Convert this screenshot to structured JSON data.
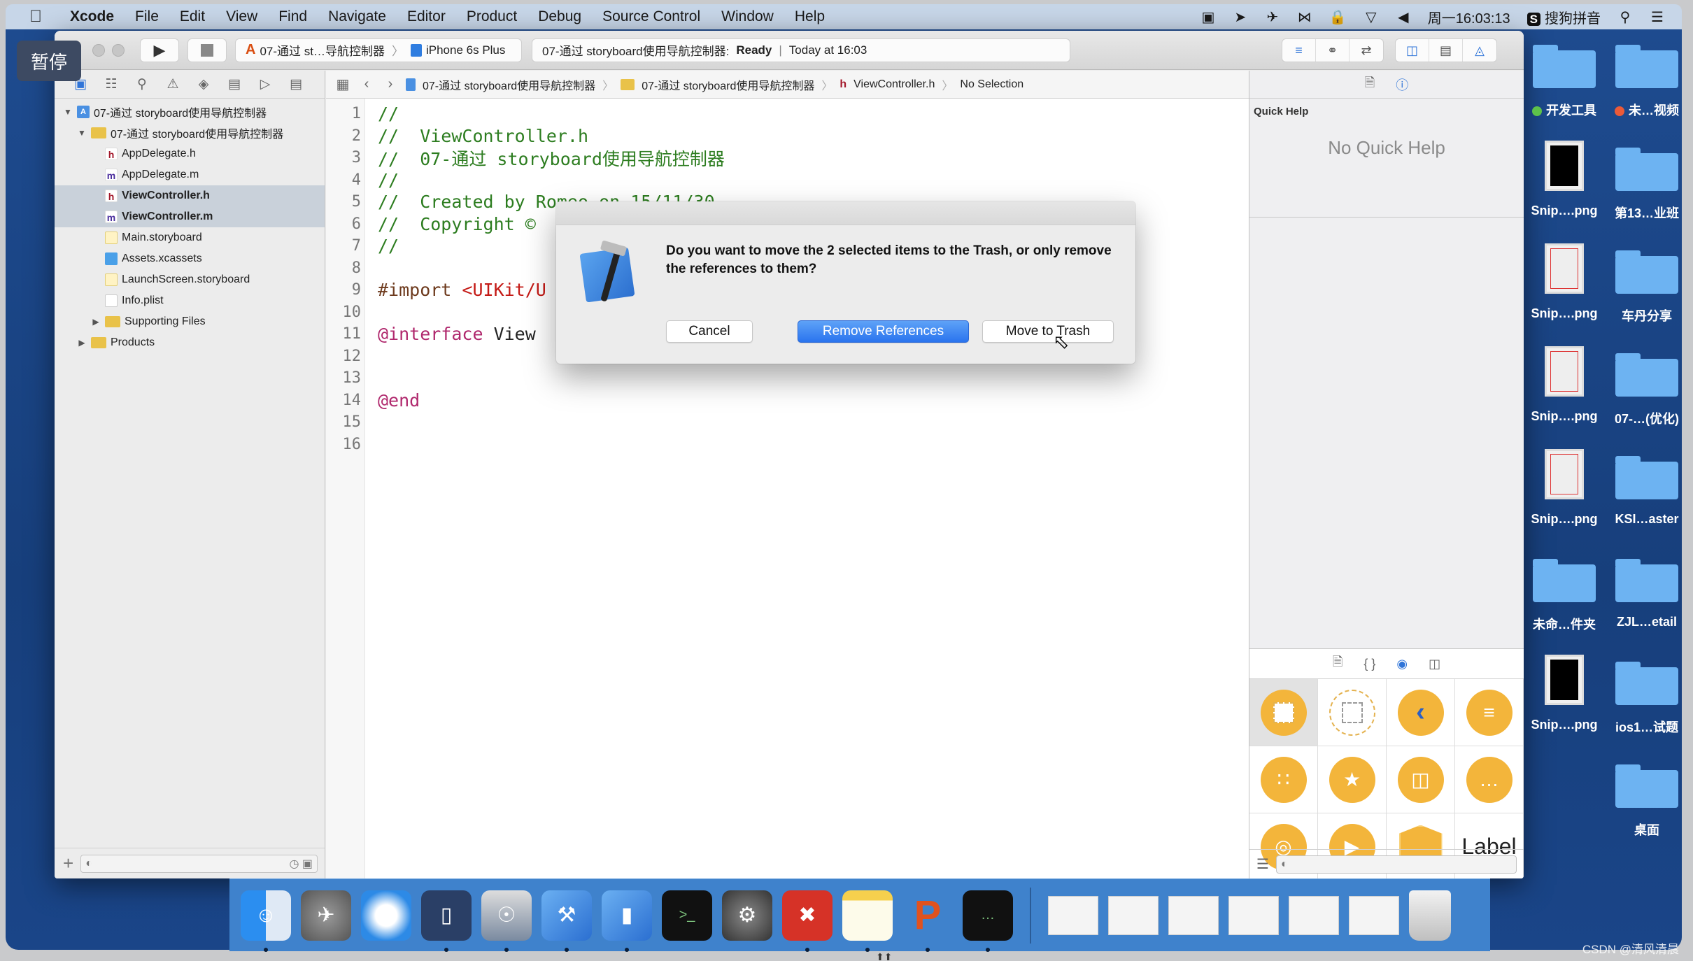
{
  "menubar": {
    "app_name": "Xcode",
    "items": [
      "File",
      "Edit",
      "View",
      "Find",
      "Navigate",
      "Editor",
      "Product",
      "Debug",
      "Source Control",
      "Window",
      "Help"
    ],
    "clock": "周一16:03:13",
    "input_method": "搜狗拼音",
    "status_icons": [
      "screen-record-icon",
      "location-icon",
      "plane-icon",
      "bluetooth-icon",
      "lock-icon",
      "wifi-icon",
      "volume-icon"
    ]
  },
  "overlay": {
    "pause_label": "暂停"
  },
  "toolbar": {
    "scheme_name": "07-通过 st…导航控制器",
    "device_name": "iPhone 6s Plus",
    "activity_project": "07-通过 storyboard使用导航控制器:",
    "activity_status": "Ready",
    "activity_time": "Today at 16:03"
  },
  "navigator": {
    "tree": [
      {
        "label": "07-通过 storyboard使用导航控制器",
        "type": "project",
        "level": 0,
        "expanded": true,
        "selected": false
      },
      {
        "label": "07-通过 storyboard使用导航控制器",
        "type": "folder",
        "level": 1,
        "expanded": true,
        "selected": false
      },
      {
        "label": "AppDelegate.h",
        "type": "h",
        "level": 2,
        "selected": false
      },
      {
        "label": "AppDelegate.m",
        "type": "m",
        "level": 2,
        "selected": false
      },
      {
        "label": "ViewController.h",
        "type": "h",
        "level": 2,
        "selected": true
      },
      {
        "label": "ViewController.m",
        "type": "m",
        "level": 2,
        "selected": true
      },
      {
        "label": "Main.storyboard",
        "type": "storyboard",
        "level": 2,
        "selected": false
      },
      {
        "label": "Assets.xcassets",
        "type": "assets",
        "level": 2,
        "selected": false
      },
      {
        "label": "LaunchScreen.storyboard",
        "type": "storyboard",
        "level": 2,
        "selected": false
      },
      {
        "label": "Info.plist",
        "type": "plist",
        "level": 2,
        "selected": false
      },
      {
        "label": "Supporting Files",
        "type": "folder",
        "level": 2,
        "expanded": false,
        "selected": false
      },
      {
        "label": "Products",
        "type": "folder",
        "level": 1,
        "expanded": false,
        "selected": false
      }
    ]
  },
  "jumpbar": {
    "crumbs": [
      "07-通过 storyboard使用导航控制器",
      "07-通过 storyboard使用导航控制器",
      "ViewController.h",
      "No Selection"
    ]
  },
  "editor": {
    "lines": [
      {
        "n": "1",
        "segments": [
          {
            "t": "//",
            "c": "com"
          }
        ]
      },
      {
        "n": "2",
        "segments": [
          {
            "t": "//  ViewController.h",
            "c": "com"
          }
        ]
      },
      {
        "n": "3",
        "segments": [
          {
            "t": "//  07-通过 storyboard使用导航控制器",
            "c": "com"
          }
        ]
      },
      {
        "n": "4",
        "segments": [
          {
            "t": "//",
            "c": "com"
          }
        ]
      },
      {
        "n": "5",
        "segments": [
          {
            "t": "//  Created by Romeo on 15/11/30",
            "c": "com"
          }
        ]
      },
      {
        "n": "6",
        "segments": [
          {
            "t": "//  Copyright ©",
            "c": "com"
          }
        ]
      },
      {
        "n": "7",
        "segments": [
          {
            "t": "//",
            "c": "com"
          }
        ]
      },
      {
        "n": "8",
        "segments": []
      },
      {
        "n": "9",
        "segments": [
          {
            "t": "#import ",
            "c": "pre"
          },
          {
            "t": "<UIKit/U",
            "c": "str"
          }
        ]
      },
      {
        "n": "10",
        "segments": []
      },
      {
        "n": "11",
        "segments": [
          {
            "t": "@interface",
            "c": "kw"
          },
          {
            "t": " View",
            "c": "plain"
          }
        ]
      },
      {
        "n": "12",
        "segments": []
      },
      {
        "n": "13",
        "segments": []
      },
      {
        "n": "14",
        "segments": [
          {
            "t": "@end",
            "c": "kw"
          }
        ]
      },
      {
        "n": "15",
        "segments": []
      },
      {
        "n": "16",
        "segments": []
      }
    ]
  },
  "utilities": {
    "quick_help_title": "Quick Help",
    "quick_help_empty": "No Quick Help",
    "library_items": [
      {
        "name": "view-controller",
        "kind": "solid-square"
      },
      {
        "name": "storyboard-reference",
        "kind": "dashed"
      },
      {
        "name": "navigation-controller",
        "kind": "chevron"
      },
      {
        "name": "table-view-controller",
        "kind": "lines"
      },
      {
        "name": "collection-view-controller",
        "kind": "grid"
      },
      {
        "name": "tab-bar-controller",
        "kind": "tabbar"
      },
      {
        "name": "split-view-controller",
        "kind": "split"
      },
      {
        "name": "page-view-controller",
        "kind": "page"
      },
      {
        "name": "glkit-view-controller",
        "kind": "sphere"
      },
      {
        "name": "avkit-player-view-controller",
        "kind": "player"
      },
      {
        "name": "object",
        "kind": "cube"
      },
      {
        "name": "label",
        "kind": "text",
        "text": "Label"
      }
    ]
  },
  "dialog": {
    "message": "Do you want to move the 2 selected items to the Trash, or only remove the references to them?",
    "cancel_label": "Cancel",
    "remove_label": "Remove References",
    "trash_label": "Move to Trash"
  },
  "desktop": {
    "items": [
      {
        "label": "开发工具",
        "kind": "folder",
        "tag": "#5ec24a"
      },
      {
        "label": "未…视频",
        "kind": "folder",
        "tag": "#ec5a38"
      },
      {
        "label": "Snip….png",
        "kind": "thumb-dark"
      },
      {
        "label": "第13…业班",
        "kind": "folder"
      },
      {
        "label": "Snip….png",
        "kind": "thumb-light"
      },
      {
        "label": "车丹分享",
        "kind": "folder"
      },
      {
        "label": "Snip….png",
        "kind": "thumb-light"
      },
      {
        "label": "07-…(优化)",
        "kind": "folder"
      },
      {
        "label": "Snip….png",
        "kind": "thumb-light"
      },
      {
        "label": "KSI…aster",
        "kind": "folder"
      },
      {
        "label": "未命…件夹",
        "kind": "folder"
      },
      {
        "label": "ZJL…etail",
        "kind": "folder"
      },
      {
        "label": "Snip….png",
        "kind": "thumb-dark"
      },
      {
        "label": "ios1…试题",
        "kind": "folder"
      },
      {
        "label": "",
        "kind": "empty"
      },
      {
        "label": "桌面",
        "kind": "folder"
      }
    ]
  },
  "dock": {
    "apps": [
      {
        "name": "finder",
        "running": true
      },
      {
        "name": "launchpad",
        "running": false
      },
      {
        "name": "safari",
        "running": false
      },
      {
        "name": "mouse-utility",
        "running": true
      },
      {
        "name": "screen-recorder",
        "running": true
      },
      {
        "name": "xcode",
        "running": true
      },
      {
        "name": "simulator",
        "running": true
      },
      {
        "name": "terminal",
        "running": false
      },
      {
        "name": "system-preferences",
        "running": false
      },
      {
        "name": "xmind",
        "running": true
      },
      {
        "name": "notes",
        "running": true
      },
      {
        "name": "powerpoint",
        "running": true
      },
      {
        "name": "console",
        "running": true
      }
    ],
    "minimized_windows": 6
  },
  "watermark": "CSDN @清风清晨"
}
